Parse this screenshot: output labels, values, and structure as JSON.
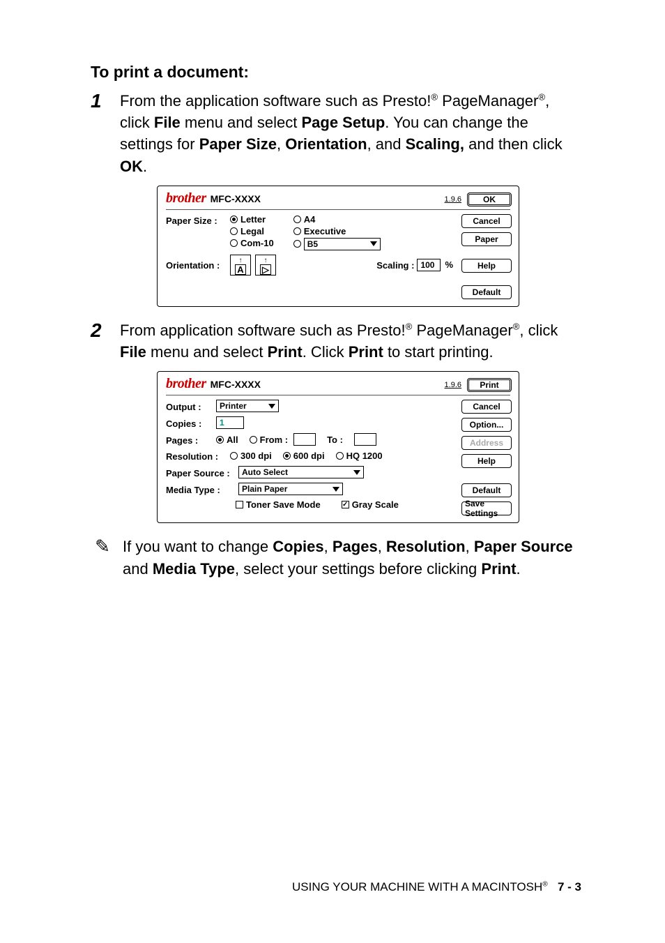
{
  "heading": "To print a document:",
  "steps": {
    "s1": {
      "num": "1",
      "p1a": "From the application software such as Presto!",
      "p1b": " PageManager",
      "p1c": ", click ",
      "p1d": "File",
      "p1e": " menu and select ",
      "p1f": "Page Setup",
      "p1g": ". You can change the settings for ",
      "p1h": "Paper Size",
      "p1i": ", ",
      "p1j": "Orientation",
      "p1k": ", and ",
      "p1l": "Scaling,",
      "p1m": " and then click ",
      "p1n": "OK",
      "p1o": "."
    },
    "s2": {
      "num": "2",
      "p2a": "From application software such as Presto!",
      "p2b": " PageManager",
      "p2c": ", click ",
      "p2d": "File",
      "p2e": " menu and select ",
      "p2f": "Print",
      "p2g": ". Click ",
      "p2h": "Print",
      "p2i": " to start printing."
    }
  },
  "dlg1": {
    "brand": "brother",
    "model": "MFC-XXXX",
    "ver": "1.9.6",
    "btn_ok": "OK",
    "btn_cancel": "Cancel",
    "btn_paper": "Paper",
    "btn_help": "Help",
    "btn_default": "Default",
    "lbl_paper_size": "Paper Size :",
    "ps_letter": "Letter",
    "ps_legal": "Legal",
    "ps_com10": "Com-10",
    "ps_a4": "A4",
    "ps_exec": "Executive",
    "ps_b5": "B5",
    "lbl_orient": "Orientation :",
    "lbl_scaling": "Scaling :",
    "scaling_val": "100",
    "pct": "%"
  },
  "dlg2": {
    "brand": "brother",
    "model": "MFC-XXXX",
    "ver": "1.9.6",
    "btn_print": "Print",
    "btn_cancel": "Cancel",
    "btn_option": "Option...",
    "btn_address": "Address",
    "btn_help": "Help",
    "btn_default": "Default",
    "btn_save": "Save Settings",
    "lbl_output": "Output :",
    "out_val": "Printer",
    "lbl_copies": "Copies :",
    "copies_val": "1",
    "lbl_pages": "Pages :",
    "pg_all": "All",
    "pg_from": "From :",
    "pg_to": "To :",
    "lbl_res": "Resolution :",
    "r300": "300 dpi",
    "r600": "600 dpi",
    "rhq": "HQ 1200",
    "lbl_src": "Paper Source :",
    "src_val": "Auto Select",
    "lbl_media": "Media Type :",
    "media_val": "Plain Paper",
    "cb_toner": "Toner Save Mode",
    "cb_gray": "Gray Scale"
  },
  "note": {
    "a": "If you want to change ",
    "b": "Copies",
    "c": ", ",
    "d": "Pages",
    "e": ", ",
    "f": "Resolution",
    "g": ", ",
    "h": "Paper Source",
    "i": " and ",
    "j": "Media Type",
    "k": ", select your settings before clicking ",
    "l": "Print",
    "m": "."
  },
  "footer": {
    "text": "USING YOUR MACHINE WITH A MACINTOSH",
    "page": "7 - 3"
  },
  "sup": "®"
}
